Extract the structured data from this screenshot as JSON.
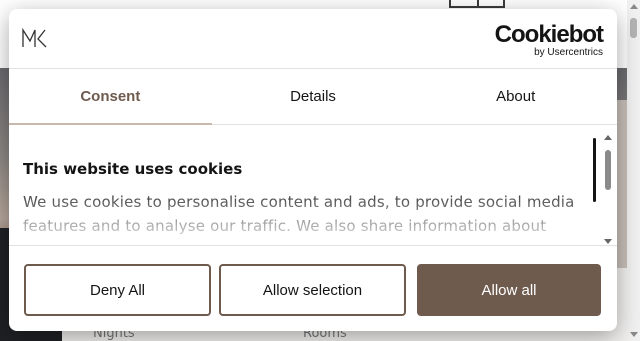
{
  "background": {
    "label_nights": "Nights",
    "label_rooms": "Rooms"
  },
  "header": {
    "brand_logo": "MK",
    "cookiebot_name": "Cookiebot",
    "cookiebot_sub": "by Usercentrics"
  },
  "tabs": [
    {
      "label": "Consent",
      "active": true
    },
    {
      "label": "Details",
      "active": false
    },
    {
      "label": "About",
      "active": false
    }
  ],
  "content": {
    "title": "This website uses cookies",
    "body": "We use cookies to personalise content and ads, to provide social media features and to analyse our traffic. We also share information about your"
  },
  "buttons": {
    "deny": "Deny All",
    "selection": "Allow selection",
    "allow_all": "Allow all"
  },
  "colors": {
    "accent": "#6f5b4e",
    "tab_underline": "#c9b9ac"
  },
  "icons": {
    "logo": "mk-logo-icon",
    "scroll_up": "chevron-up-icon",
    "scroll_down": "chevron-down-icon"
  }
}
